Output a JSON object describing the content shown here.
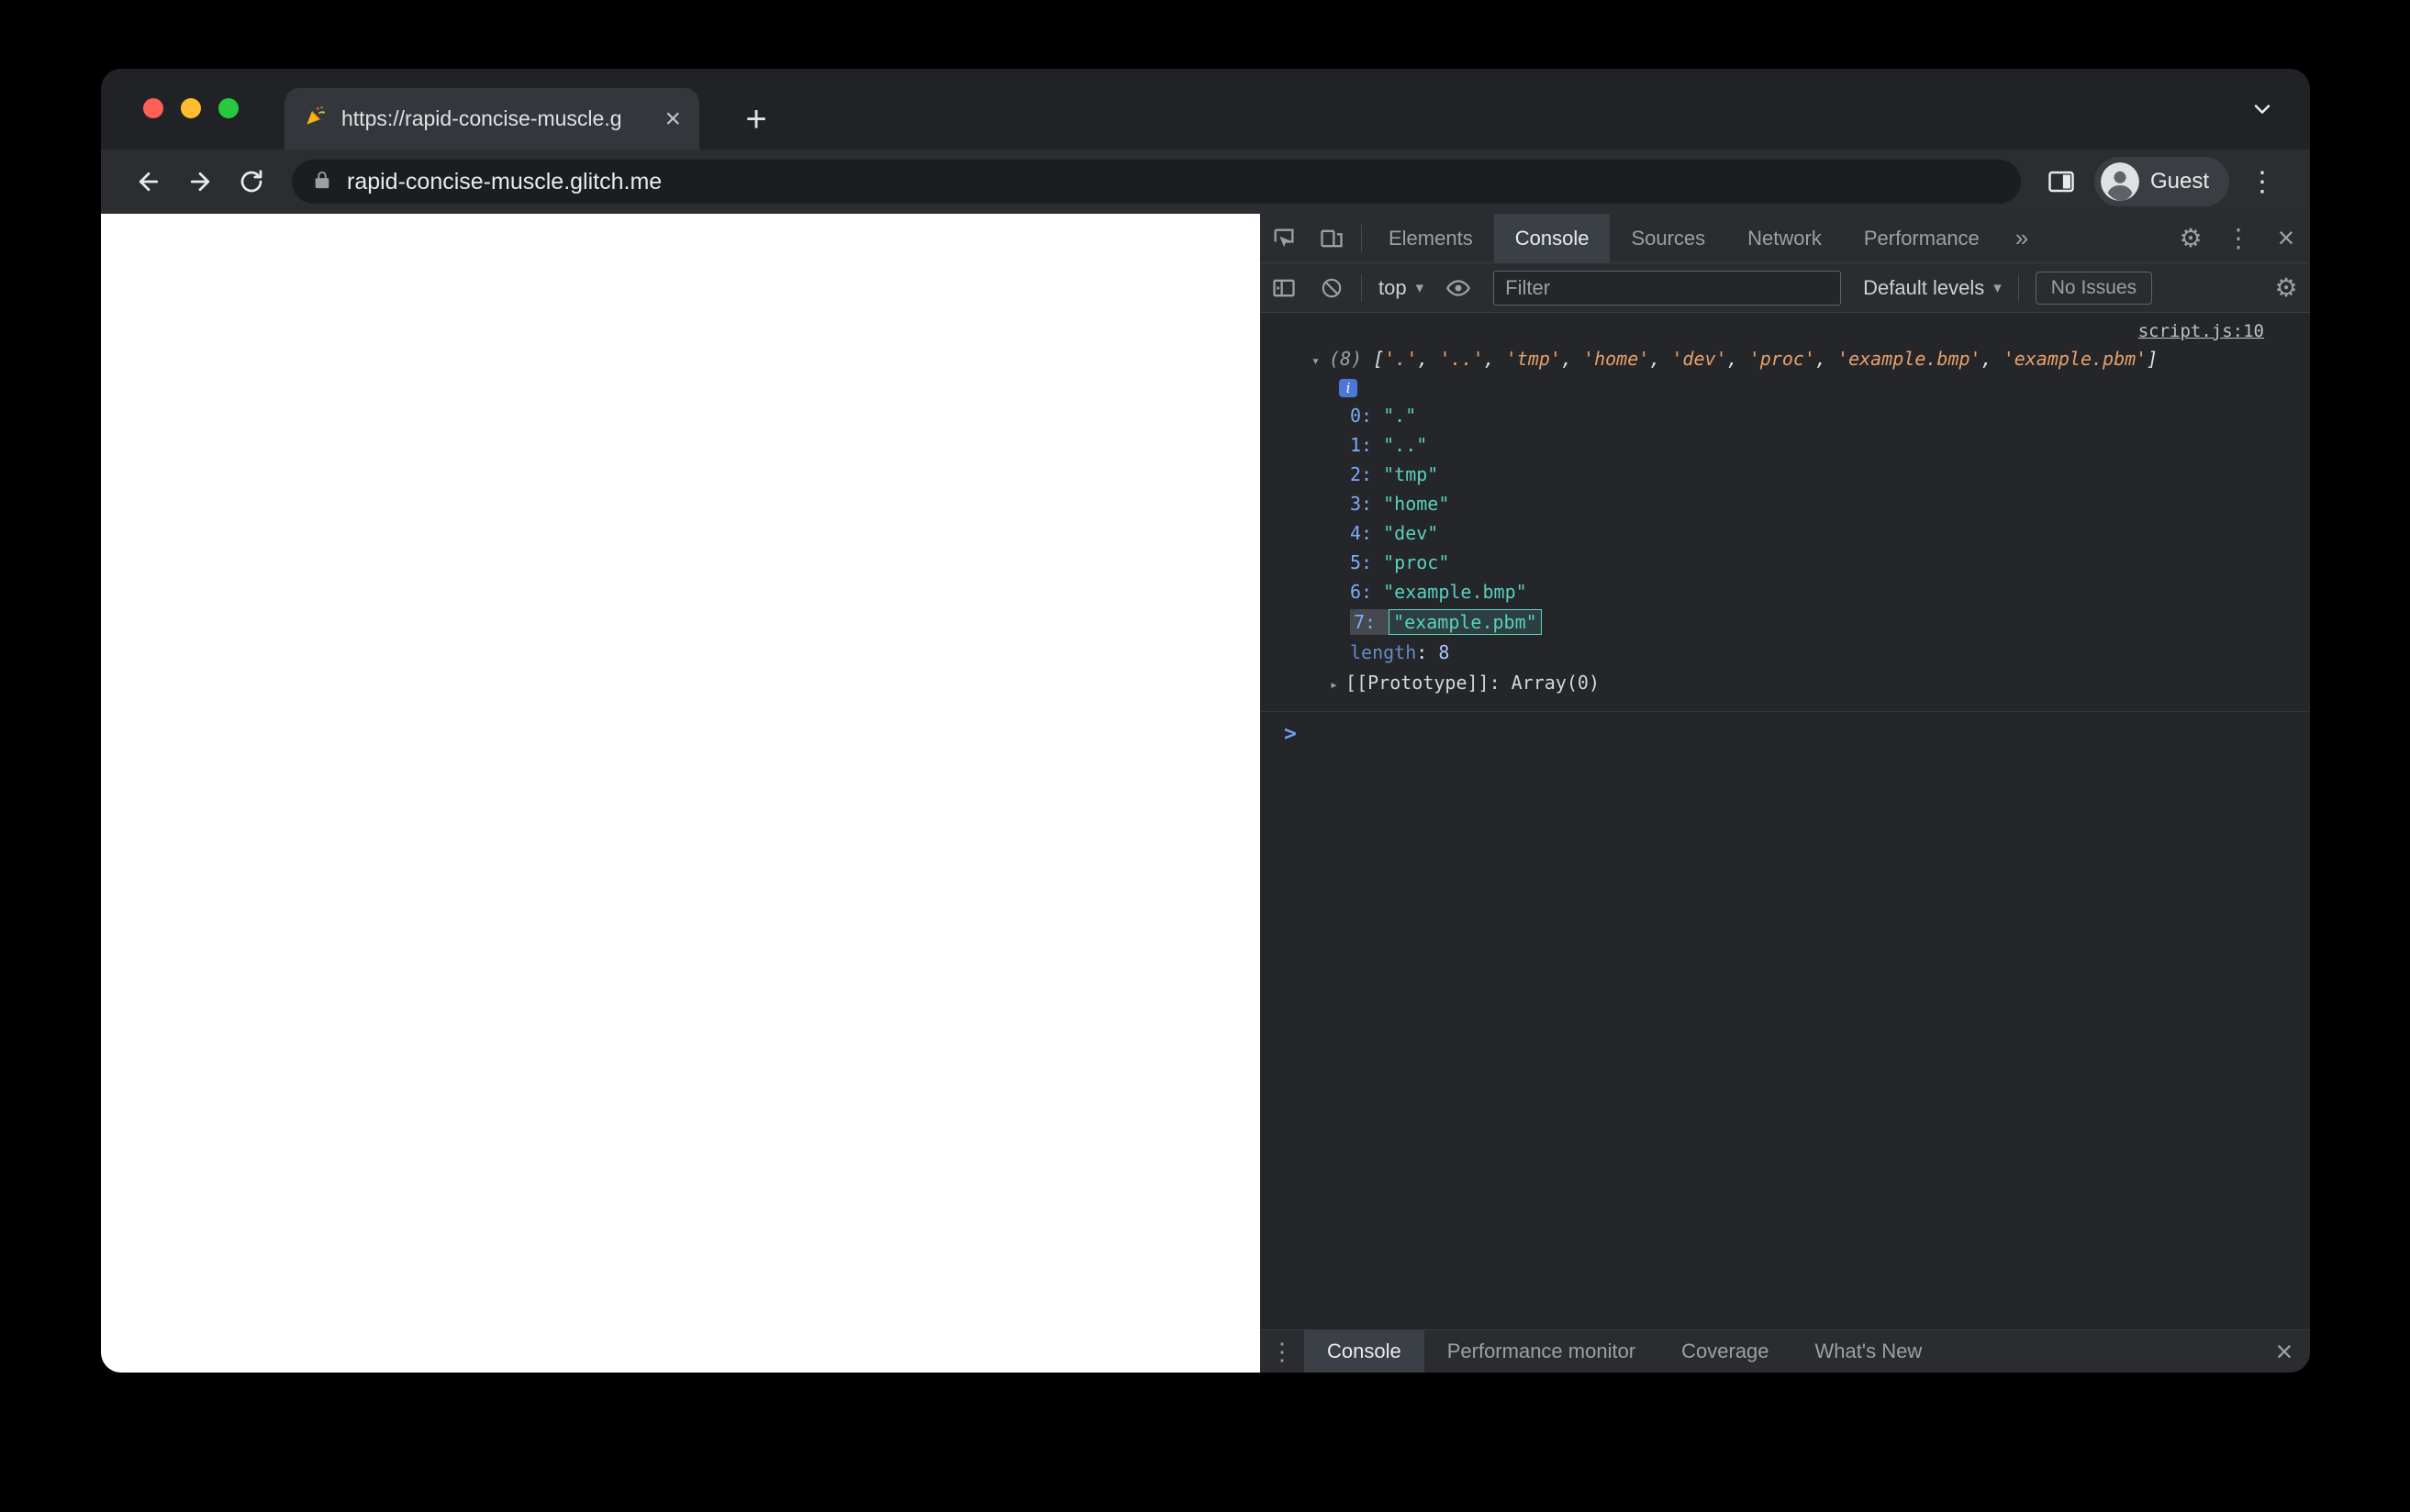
{
  "browser": {
    "tab_title": "https://rapid-concise-muscle.g",
    "url": "rapid-concise-muscle.glitch.me",
    "profile_label": "Guest",
    "new_tab_glyph": "+",
    "tab_close_glyph": "×"
  },
  "devtools": {
    "tabs": [
      {
        "label": "Elements",
        "active": false
      },
      {
        "label": "Console",
        "active": true
      },
      {
        "label": "Sources",
        "active": false
      },
      {
        "label": "Network",
        "active": false
      },
      {
        "label": "Performance",
        "active": false
      }
    ],
    "more_tabs_glyph": "»",
    "toolbar": {
      "context_label": "top",
      "filter_placeholder": "Filter",
      "levels_label": "Default levels",
      "issues_label": "No Issues"
    },
    "console": {
      "source_link": "script.js:10",
      "count_label": "(8)",
      "items": [
        ".",
        "..",
        "tmp",
        "home",
        "dev",
        "proc",
        "example.bmp",
        "example.pbm"
      ],
      "highlighted_index": 7,
      "length_label": "length",
      "length_value": "8",
      "prototype_label": "[[Prototype]]",
      "prototype_separator": ": ",
      "prototype_value": "Array(0)"
    },
    "drawer_tabs": [
      {
        "label": "Console",
        "active": true
      },
      {
        "label": "Performance monitor",
        "active": false
      },
      {
        "label": "Coverage",
        "active": false
      },
      {
        "label": "What's New",
        "active": false
      }
    ]
  },
  "colors": {
    "string_teal": "#5bd0bd",
    "preview_orange": "#e8a16c",
    "index_blue": "#7cacf8",
    "accent_blue": "#6ea0f7"
  }
}
